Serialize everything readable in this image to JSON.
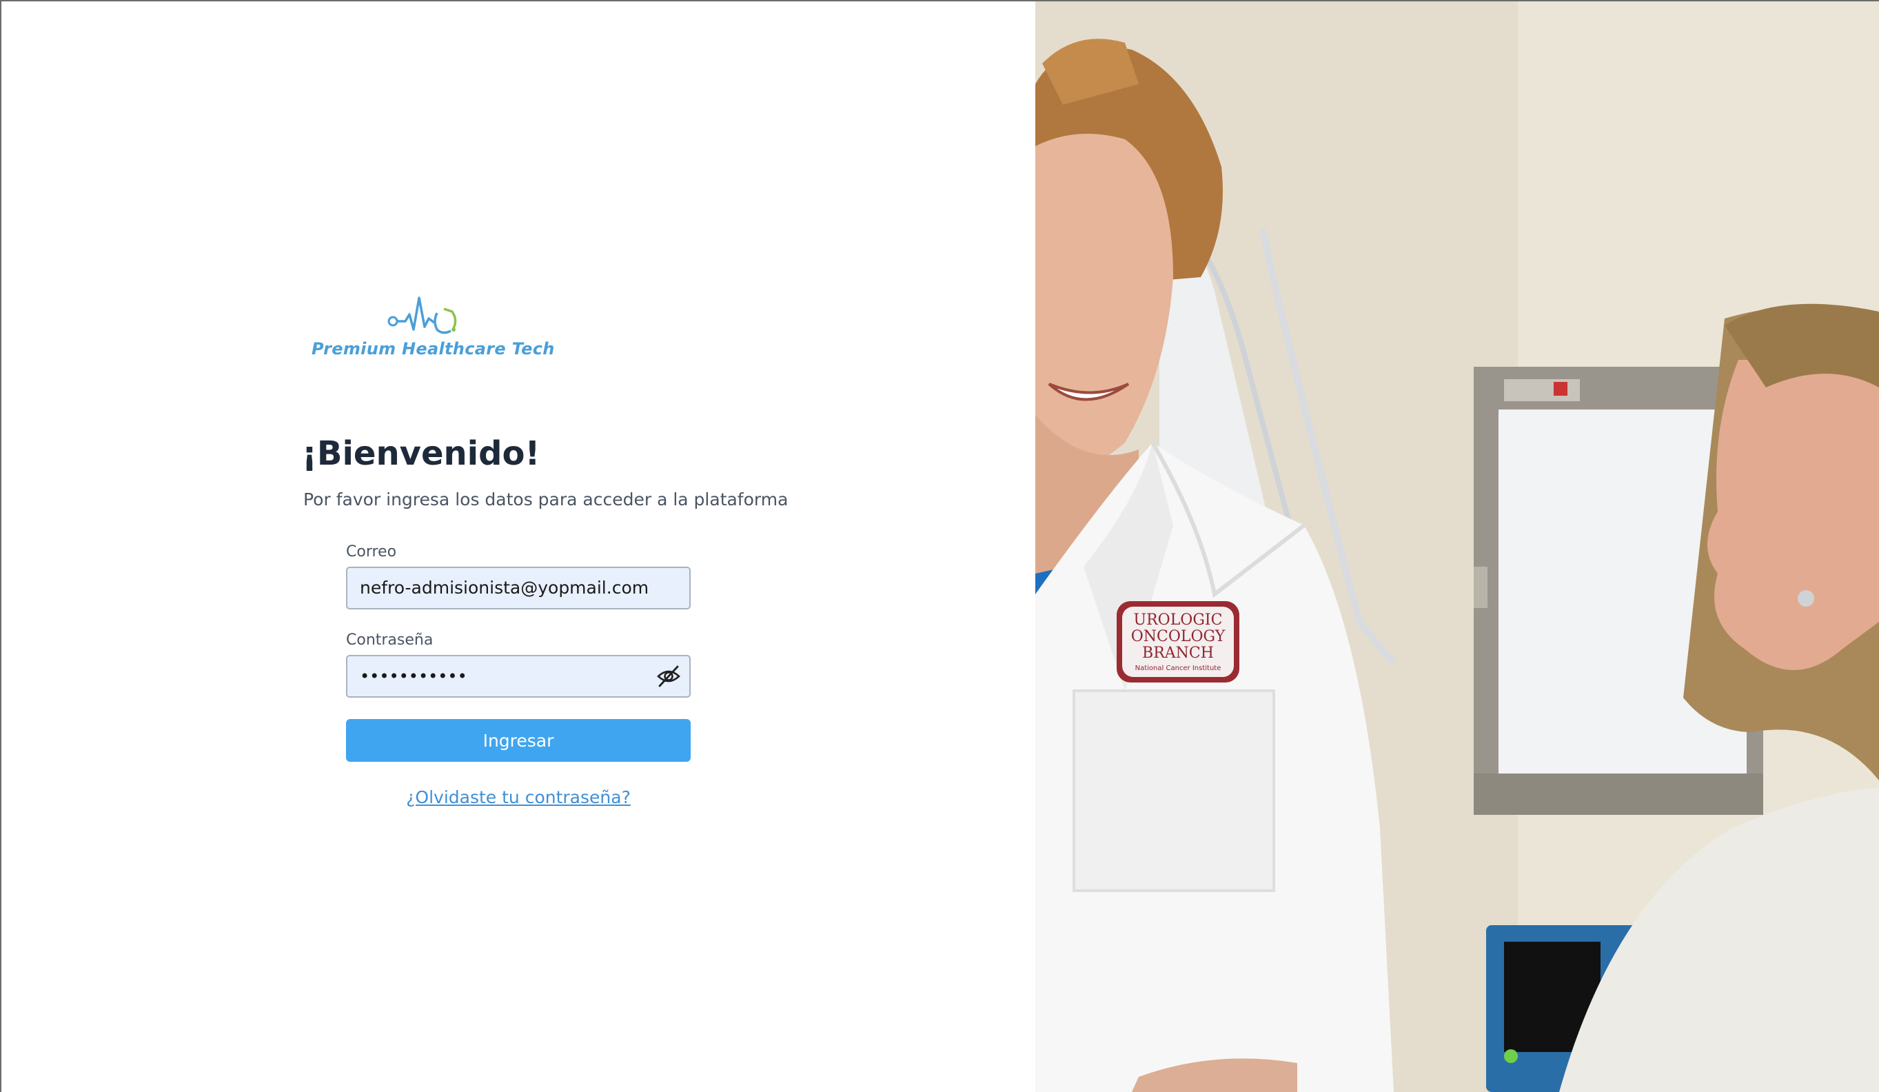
{
  "brand": {
    "name": "Premium Healthcare Tech",
    "logo_icon": "stethoscope-heartbeat-icon",
    "color": "#4a9fd8"
  },
  "welcome": {
    "title": "¡Bienvenido!",
    "subtitle": "Por favor ingresa los datos para acceder a la plataforma"
  },
  "form": {
    "email": {
      "label": "Correo",
      "value": "nefro-admisionista@yopmail.com"
    },
    "password": {
      "label": "Contraseña",
      "masked_value": "•••••••••••",
      "toggle_icon": "eye-slash-icon"
    },
    "submit_label": "Ingresar",
    "forgot_password_label": "¿Olvidaste tu contraseña?"
  },
  "photo": {
    "patch_lines": [
      "UROLOGIC",
      "ONCOLOGY",
      "BRANCH"
    ],
    "patch_footer": "National Cancer Institute"
  },
  "colors": {
    "primary_button": "#3fa5f0",
    "input_background": "#e8f0fd",
    "link": "#3f8fd6",
    "title": "#1e2a3a"
  }
}
